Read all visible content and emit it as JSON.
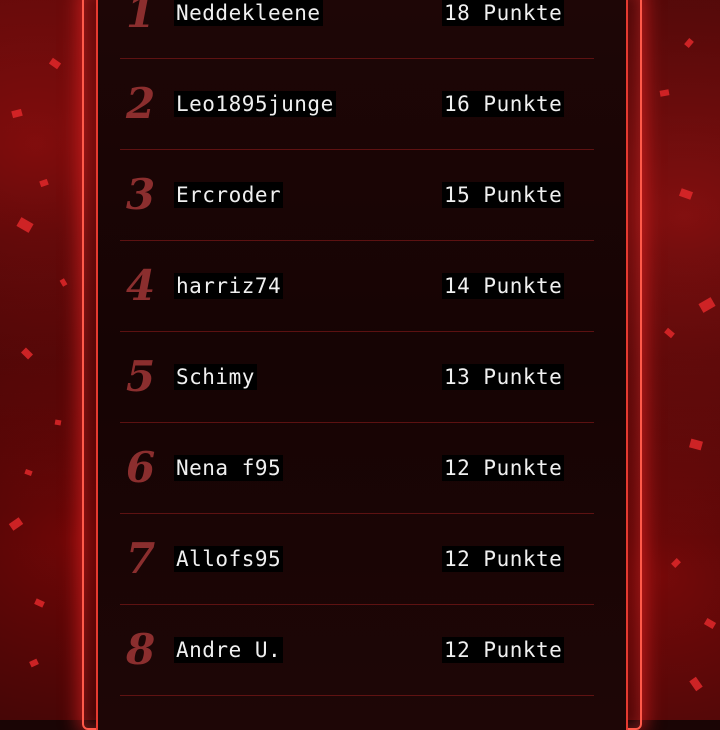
{
  "leaderboard": {
    "entries": [
      {
        "rank": "1",
        "name": "Neddekleene",
        "points": "18 Punkte"
      },
      {
        "rank": "2",
        "name": "Leo1895junge",
        "points": "16 Punkte"
      },
      {
        "rank": "3",
        "name": "Ercroder",
        "points": "15 Punkte"
      },
      {
        "rank": "4",
        "name": "harriz74",
        "points": "14 Punkte"
      },
      {
        "rank": "5",
        "name": "Schimy",
        "points": "13 Punkte"
      },
      {
        "rank": "6",
        "name": "Nena f95",
        "points": "12 Punkte"
      },
      {
        "rank": "7",
        "name": "Allofs95",
        "points": "12 Punkte"
      },
      {
        "rank": "8",
        "name": "Andre U.",
        "points": "12 Punkte"
      }
    ]
  },
  "colors": {
    "accent": "#ff3a30",
    "rank_number": "#8b2e2e",
    "text": "#f0f0f0",
    "text_background": "#000000"
  }
}
